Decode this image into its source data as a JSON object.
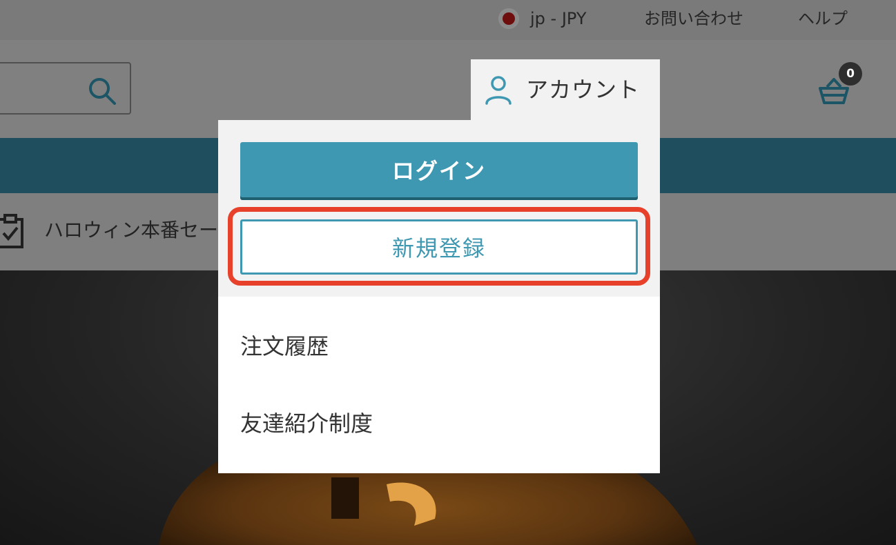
{
  "topbar": {
    "locale_label": "jp - JPY",
    "contact_label": "お問い合わせ",
    "help_label": "ヘルプ"
  },
  "header": {
    "account_label": "アカウント",
    "cart_count": "0"
  },
  "promo": {
    "text": "ハロウィン本番セール"
  },
  "account_menu": {
    "login_label": "ログイン",
    "register_label": "新規登録",
    "items": [
      {
        "label": "注文履歴"
      },
      {
        "label": "友達紹介制度"
      }
    ]
  },
  "colors": {
    "accent": "#3f98b1",
    "highlight": "#e8412b",
    "nav": "#1f4e5e",
    "overlay_dim": "#7f7f7f"
  },
  "icons": [
    "flag-icon",
    "search-icon",
    "account-icon",
    "cart-icon",
    "clipboard-check-icon"
  ]
}
